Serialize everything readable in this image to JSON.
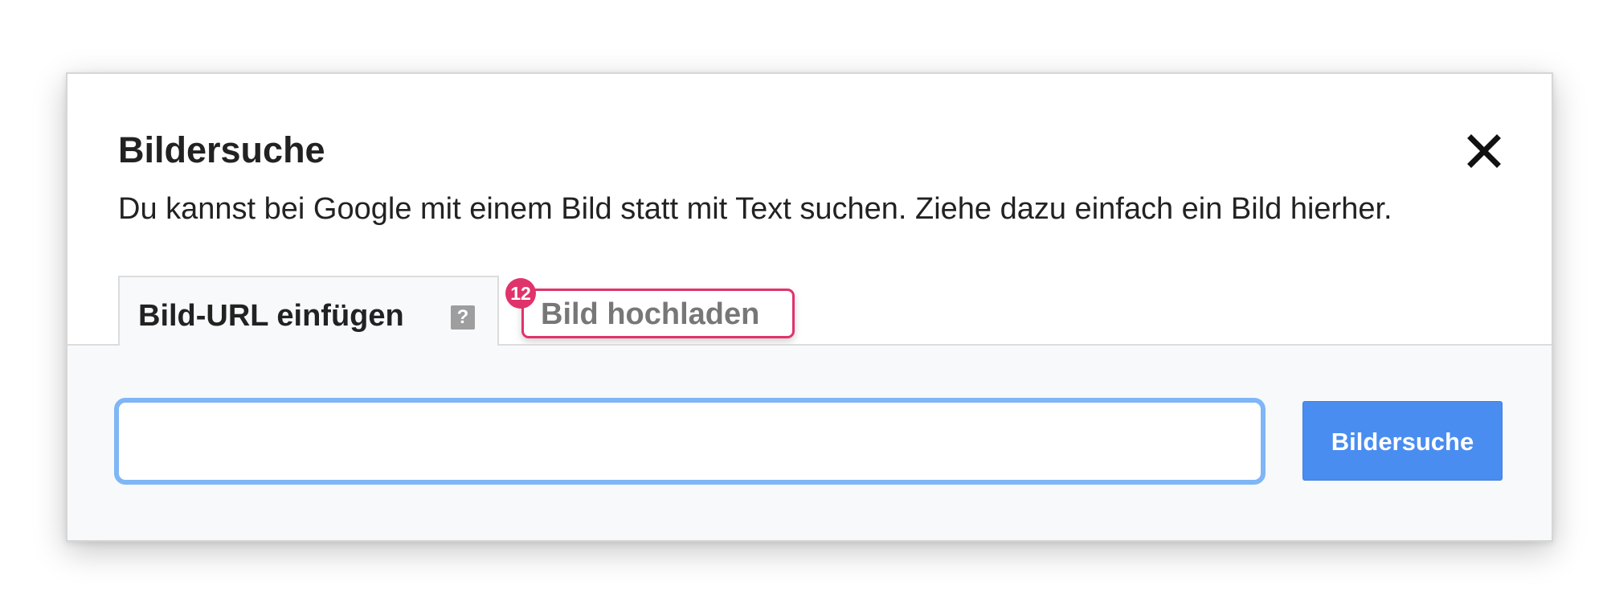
{
  "dialog": {
    "title": "Bildersuche",
    "description": "Du kannst bei Google mit einem Bild statt mit Text suchen. Ziehe dazu einfach ein Bild hierher.",
    "close_icon": "close-icon"
  },
  "tabs": [
    {
      "label": "Bild-URL einfügen",
      "active": true,
      "help_icon": "help-icon",
      "help_glyph": "?"
    },
    {
      "label": "Bild hochladen",
      "active": false,
      "marker": "12"
    }
  ],
  "search": {
    "input_value": "",
    "input_placeholder": "",
    "button_label": "Bildersuche"
  },
  "colors": {
    "accent": "#4a8df0",
    "input_focus_border": "#7fb6f5",
    "marker": "#e0336b",
    "panel_bg": "#f8f9fa"
  }
}
